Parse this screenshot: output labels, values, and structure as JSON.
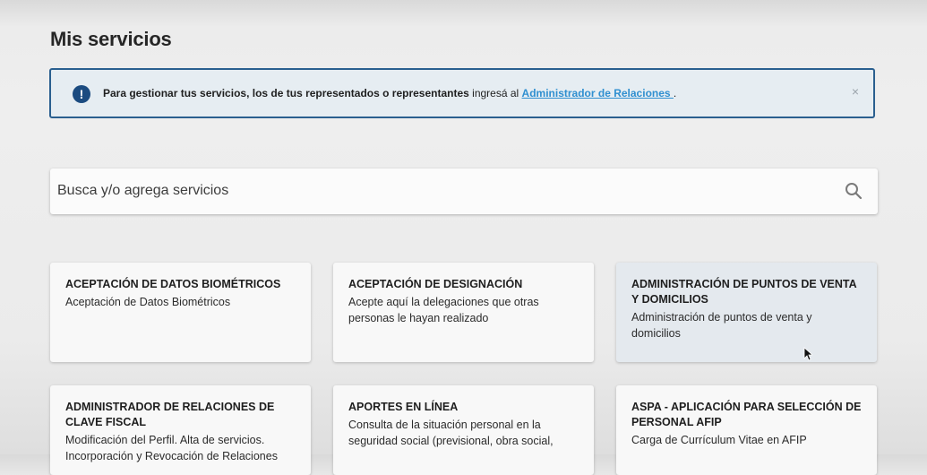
{
  "page": {
    "title": "Mis servicios"
  },
  "alert": {
    "icon": "exclamation-circle-icon",
    "text_bold": "Para gestionar tus servicios, los de tus representados o representantes",
    "text_regular": " ingresá al ",
    "link_text": "Administrador de Relaciones ",
    "text_after": ".",
    "close_label": "×"
  },
  "search": {
    "placeholder": "Busca y/o agrega servicios",
    "icon": "search-icon"
  },
  "services": [
    {
      "title": "ACEPTACIÓN DE DATOS BIOMÉTRICOS",
      "description": "Aceptación de Datos Biométricos"
    },
    {
      "title": "ACEPTACIÓN DE DESIGNACIÓN",
      "description": "Acepte aquí la delegaciones que otras personas le hayan realizado"
    },
    {
      "title": "ADMINISTRACIÓN DE PUNTOS DE VENTA Y DOMICILIOS",
      "description": "Administración de puntos de venta y domicilios"
    },
    {
      "title": "ADMINISTRADOR DE RELACIONES DE CLAVE FISCAL",
      "description": "Modificación del Perfil. Alta de servicios. Incorporación y Revocación de Relaciones"
    },
    {
      "title": "APORTES EN LÍNEA",
      "description": "Consulta de la situación personal en la seguridad social (previsional, obra social,"
    },
    {
      "title": "ASPA - APLICACIÓN PARA SELECCIÓN DE PERSONAL AFIP",
      "description": "Carga de Currículum Vitae en AFIP"
    }
  ],
  "colors": {
    "alert_border": "#2a5f8f",
    "alert_background": "#e6edf2",
    "link": "#2f8fd0",
    "icon": "#1b4b80",
    "card_hover": "#e4e9ee"
  }
}
